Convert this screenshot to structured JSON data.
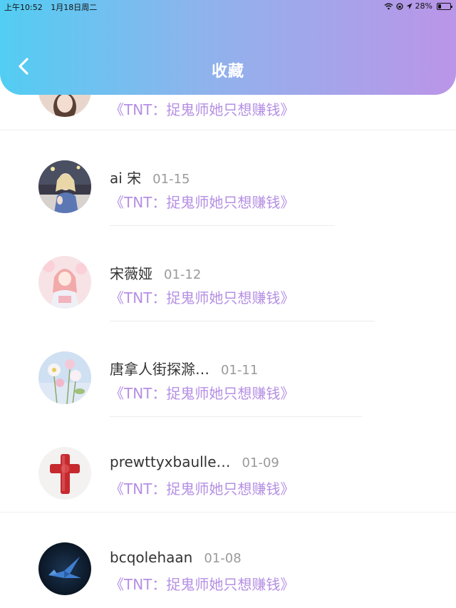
{
  "status_bar": {
    "time": "上午10:52",
    "date": "1月18日周二",
    "battery": "28%",
    "battery_level": 0.28,
    "icons": [
      "wifi-icon",
      "lock-rotation-icon",
      "location-arrow-icon",
      "battery-icon"
    ]
  },
  "header": {
    "title": "收藏",
    "back_icon": "chevron-left-icon",
    "gradient": [
      "#52cdf3",
      "#bb95e8"
    ]
  },
  "list": {
    "partial_item": {
      "book": "《TNT：捉鬼师她只想赚钱》"
    },
    "items": [
      {
        "name": "ai 宋",
        "date": "01-15",
        "book": "《TNT：捉鬼师她只想赚钱》",
        "avatar": "avatar-girl-photo"
      },
      {
        "name": "宋薇娅",
        "date": "01-12",
        "book": "《TNT：捉鬼师她只想赚钱》",
        "avatar": "avatar-pink-anime"
      },
      {
        "name": "唐拿人街探滁…",
        "date": "01-11",
        "book": "《TNT：捉鬼师她只想赚钱》",
        "avatar": "avatar-flowers"
      },
      {
        "name": "prewttyxbaulle…",
        "date": "01-09",
        "book": "《TNT：捉鬼师她只想赚钱》",
        "avatar": "avatar-red-cross"
      },
      {
        "name": "bcqolehaan",
        "date": "01-08",
        "book": "《TNT：捉鬼师她只想赚钱》",
        "avatar": "avatar-paper-crane"
      }
    ]
  },
  "colors": {
    "accent": "#b58fe3",
    "name_text": "#333333",
    "date_text": "#9a9a9a"
  }
}
